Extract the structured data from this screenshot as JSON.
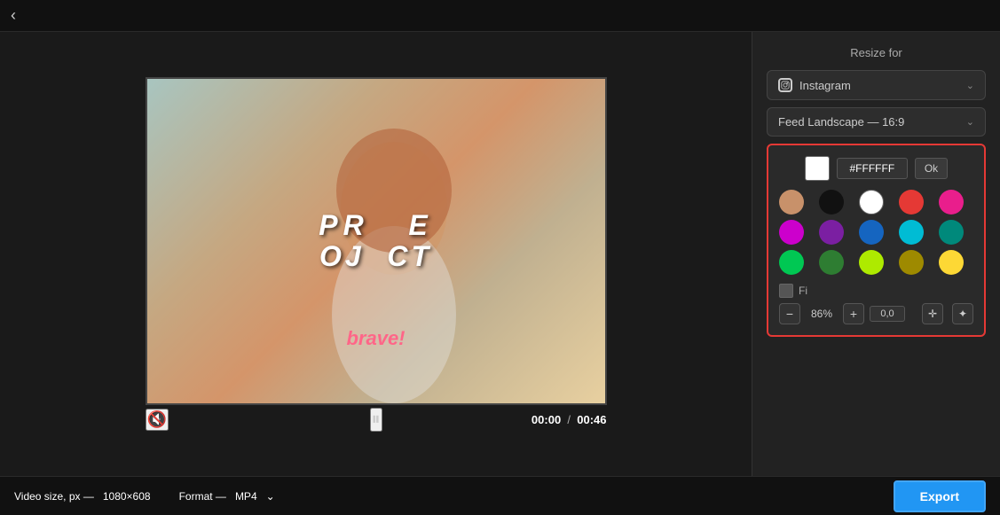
{
  "topBar": {
    "backLabel": "‹"
  },
  "video": {
    "projectText": "PROJECT",
    "braveText": "brave!",
    "time": "00:00",
    "duration": "00:46",
    "muteIcon": "🔇",
    "playIcon": "⏸"
  },
  "rightPanel": {
    "resizeLabel": "Resize for",
    "platformDropdown": "Instagram",
    "formatDropdown": "Feed Landscape — 16:9",
    "colorPicker": {
      "hexValue": "#FFFFFF",
      "okLabel": "Ok",
      "colors": [
        {
          "name": "skin",
          "hex": "#c8916a"
        },
        {
          "name": "black",
          "hex": "#111111"
        },
        {
          "name": "white",
          "hex": "#ffffff"
        },
        {
          "name": "red",
          "hex": "#e53935"
        },
        {
          "name": "pink",
          "hex": "#e91e8c"
        },
        {
          "name": "magenta",
          "hex": "#cc00cc"
        },
        {
          "name": "purple",
          "hex": "#7b1fa2"
        },
        {
          "name": "blue",
          "hex": "#1565c0"
        },
        {
          "name": "cyan",
          "hex": "#00bcd4"
        },
        {
          "name": "teal",
          "hex": "#00897b"
        },
        {
          "name": "green1",
          "hex": "#00c853"
        },
        {
          "name": "green2",
          "hex": "#2e7d32"
        },
        {
          "name": "lime",
          "hex": "#aeea00"
        },
        {
          "name": "olive",
          "hex": "#9e8a00"
        },
        {
          "name": "yellow",
          "hex": "#fdd835"
        }
      ],
      "fillLabel": "Fi",
      "zoomPercent": "86%",
      "coordinates": "0,0"
    }
  },
  "bottomBar": {
    "videoSizeLabel": "Video size, px —",
    "videoSizeValue": "1080×608",
    "formatLabel": "Format —",
    "formatValue": "MP4",
    "exportLabel": "Export"
  }
}
